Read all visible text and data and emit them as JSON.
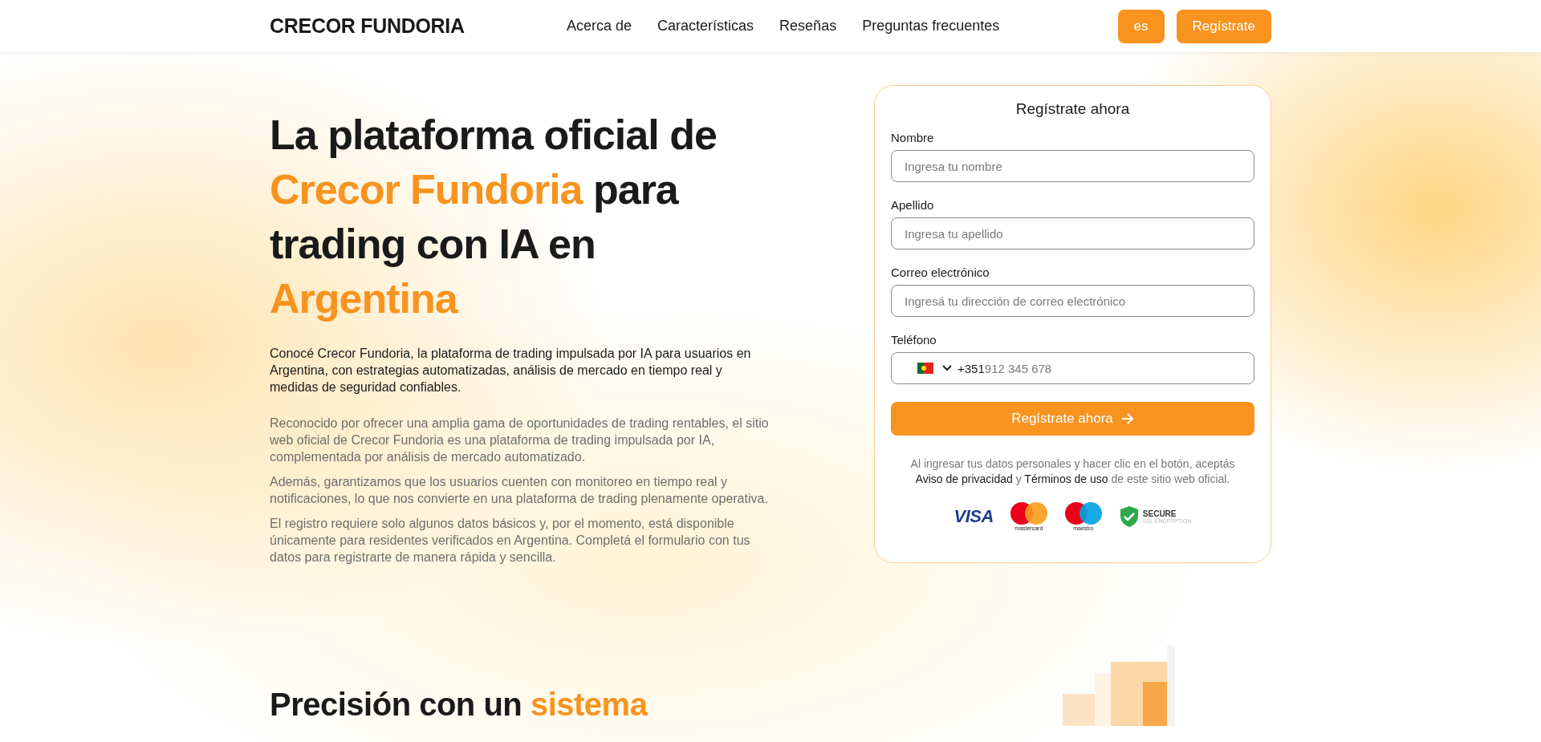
{
  "header": {
    "logo": "CRECOR FUNDORIA",
    "nav": [
      "Acerca de",
      "Características",
      "Reseñas",
      "Preguntas frecuentes"
    ],
    "language_button": "es",
    "register_button": "Regístrate"
  },
  "hero": {
    "heading": [
      {
        "text": "La plataforma oficial de",
        "accent": false
      },
      {
        "text": "Crecor Fundoria",
        "accent": true
      },
      {
        "text": "para trading con IA en",
        "accent": false
      },
      {
        "text": "Argentina",
        "accent": true
      }
    ],
    "intro": "Conocé Crecor Fundoria, la plataforma de trading impulsada por IA para usuarios en Argentina, con estrategias automatizadas, análisis de mercado en tiempo real y medidas de seguridad confiables.",
    "paragraphs": [
      "Reconocido por ofrecer una amplia gama de oportunidades de trading rentables, el sitio web oficial de Crecor Fundoria es una plataforma de trading impulsada por IA, complementada por análisis de mercado automatizado.",
      "Además, garantizamos que los usuarios cuenten con monitoreo en tiempo real y notificaciones, lo que nos convierte en una plataforma de trading plenamente operativa.",
      "El registro requiere solo algunos datos básicos y, por el momento, está disponible únicamente para residentes verificados en Argentina. Completá el formulario con tus datos para registrarte de manera rápida y sencilla."
    ]
  },
  "form": {
    "title": "Regístrate ahora",
    "fields": [
      {
        "kind": "text",
        "label": "Nombre",
        "placeholder": "Ingresa tu nombre"
      },
      {
        "kind": "text",
        "label": "Apellido",
        "placeholder": "Ingresa tu apellido"
      },
      {
        "kind": "text",
        "label": "Correo electrónico",
        "placeholder": "Ingresá tu dirección de correo electrónico"
      },
      {
        "kind": "phone",
        "label": "Teléfono",
        "dial_code": "+351",
        "placeholder": "912 345 678"
      }
    ],
    "submit": "Regístrate ahora",
    "consent": {
      "before": "Al ingresar tus datos personales y hacer clic en el botón, aceptás",
      "link_1": "Aviso de privacidad",
      "middle": "y",
      "link_2": "Términos de uso",
      "after": "de este sitio web oficial."
    },
    "badges": {
      "visa": "VISA",
      "mastercard": "mastercard",
      "maestro": "maestro",
      "secure_title": "SECURE",
      "secure_subtitle": "SSL ENCRYPTION"
    }
  },
  "next_section": {
    "heading": [
      {
        "text": "Precisión con un",
        "accent": false
      },
      {
        "text": "sistema",
        "accent": true
      }
    ]
  }
}
